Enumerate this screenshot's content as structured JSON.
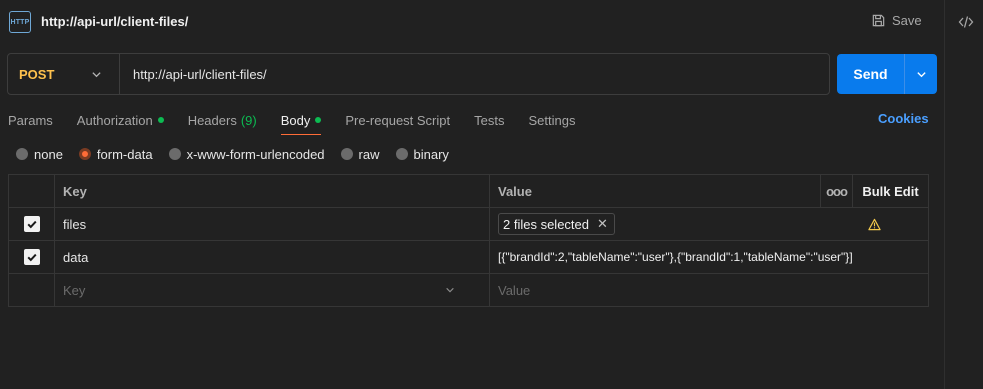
{
  "header": {
    "icon_text": "HTTP",
    "title": "http://api-url/client-files/",
    "save_label": "Save"
  },
  "request": {
    "method": "POST",
    "url": "http://api-url/client-files/",
    "send_label": "Send"
  },
  "tabs": [
    {
      "label": "Params"
    },
    {
      "label": "Authorization",
      "dot": true
    },
    {
      "label": "Headers",
      "count": "(9)"
    },
    {
      "label": "Body",
      "dot": true,
      "active": true
    },
    {
      "label": "Pre-request Script"
    },
    {
      "label": "Tests"
    },
    {
      "label": "Settings"
    }
  ],
  "cookies_label": "Cookies",
  "body_types": [
    {
      "label": "none"
    },
    {
      "label": "form-data",
      "checked": true
    },
    {
      "label": "x-www-form-urlencoded"
    },
    {
      "label": "raw"
    },
    {
      "label": "binary"
    }
  ],
  "table": {
    "headers": {
      "key": "Key",
      "value": "Value",
      "more": "ooo",
      "bulk_edit": "Bulk Edit"
    },
    "rows": [
      {
        "key": "files",
        "value": "2 files selected",
        "type": "file"
      },
      {
        "key": "data",
        "value": "[{\"brandId\":2,\"tableName\":\"user\"},{\"brandId\":1,\"tableName\":\"user\"}]",
        "type": "text"
      }
    ],
    "placeholder_key": "Key",
    "placeholder_value": "Value"
  },
  "colors": {
    "accent": "#ff6c37",
    "send": "#097bed",
    "method": "#ffc24d",
    "status_dot": "#0cbb52",
    "link": "#4a9fff"
  }
}
